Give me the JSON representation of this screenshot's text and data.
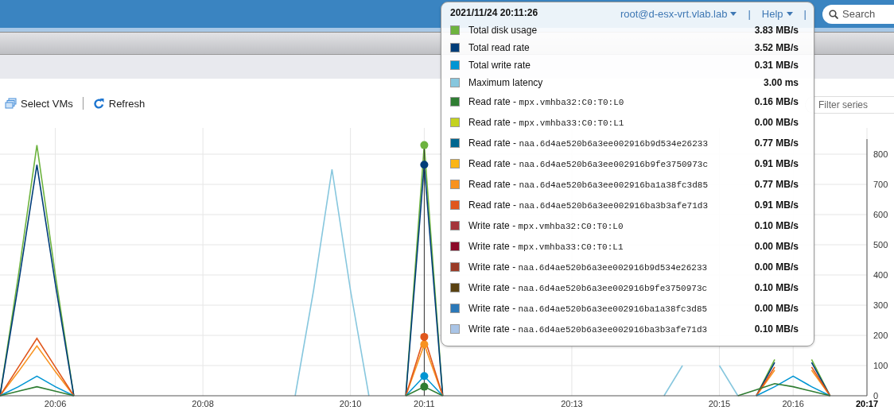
{
  "header": {
    "user": "root@d-esx-vrt.vlab.lab",
    "separator_1": "|",
    "help": "Help",
    "separator_2": "|",
    "search": {
      "placeholder": "Search"
    }
  },
  "toolbar": {
    "buttons": [
      {
        "kind": "select",
        "label": "Select VMs"
      },
      {
        "kind": "refresh",
        "label": "Refresh"
      }
    ]
  },
  "filter": {
    "placeholder": "Filter series"
  },
  "chart": {
    "chart_data": {
      "type": "line",
      "categories": [
        null,
        null,
        null,
        "20:06",
        null,
        null,
        null,
        null,
        null,
        null,
        null,
        "20:08",
        null,
        null,
        null,
        null,
        null,
        null,
        null,
        "20:10",
        null,
        null,
        null,
        "20:11",
        null,
        null,
        null,
        null,
        null,
        null,
        null,
        "20:13",
        null,
        null,
        null,
        null,
        null,
        null,
        null,
        "20:15",
        null,
        null,
        null,
        "20:16",
        null,
        null,
        null,
        "20:17"
      ],
      "series": [
        {
          "color": "#87c7de",
          "values": [
            null,
            null,
            null,
            null,
            null,
            null,
            null,
            null,
            null,
            null,
            null,
            null,
            null,
            null,
            null,
            null,
            0,
            350,
            750,
            350,
            0,
            null,
            null,
            null,
            null,
            null,
            null,
            null,
            null,
            null,
            null,
            null,
            null,
            null,
            null,
            null,
            0,
            100,
            null,
            100,
            0,
            null,
            null,
            null,
            null,
            null,
            null,
            null
          ]
        },
        {
          "color": "#6db33f",
          "values": [
            0,
            400,
            830,
            400,
            0,
            null,
            null,
            null,
            null,
            null,
            null,
            null,
            null,
            null,
            null,
            null,
            null,
            null,
            null,
            null,
            null,
            null,
            0,
            830,
            0,
            null,
            null,
            null,
            null,
            null,
            null,
            null,
            null,
            null,
            null,
            null,
            null,
            null,
            null,
            null,
            null,
            0,
            120,
            null,
            120,
            0,
            null,
            null
          ]
        },
        {
          "color": "#003d79",
          "values": [
            0,
            370,
            765,
            370,
            0,
            null,
            null,
            null,
            null,
            null,
            null,
            null,
            null,
            null,
            null,
            null,
            null,
            null,
            null,
            null,
            null,
            null,
            0,
            765,
            0,
            null,
            null,
            null,
            null,
            null,
            null,
            null,
            null,
            null,
            null,
            null,
            null,
            null,
            null,
            null,
            null,
            0,
            110,
            null,
            110,
            0,
            null,
            null
          ]
        },
        {
          "color": "#f8921f",
          "values": [
            0,
            80,
            165,
            80,
            0,
            null,
            null,
            null,
            null,
            null,
            null,
            null,
            null,
            null,
            null,
            null,
            null,
            null,
            null,
            null,
            null,
            null,
            0,
            170,
            0,
            null,
            null,
            null,
            null,
            null,
            null,
            null,
            null,
            null,
            null,
            null,
            null,
            null,
            null,
            null,
            null,
            0,
            85,
            null,
            85,
            0,
            null,
            null
          ]
        },
        {
          "color": "#e0571c",
          "values": [
            0,
            95,
            190,
            95,
            0,
            null,
            null,
            null,
            null,
            null,
            null,
            null,
            null,
            null,
            null,
            null,
            null,
            null,
            null,
            null,
            null,
            null,
            0,
            195,
            0,
            null,
            null,
            null,
            null,
            null,
            null,
            null,
            null,
            null,
            null,
            null,
            null,
            null,
            null,
            null,
            null,
            0,
            95,
            null,
            95,
            0,
            null,
            null
          ]
        },
        {
          "color": "#0095d3",
          "values": [
            0,
            30,
            65,
            30,
            0,
            null,
            null,
            null,
            null,
            null,
            null,
            null,
            null,
            null,
            null,
            null,
            null,
            null,
            null,
            null,
            null,
            null,
            0,
            65,
            0,
            null,
            null,
            null,
            null,
            null,
            null,
            null,
            null,
            null,
            null,
            null,
            null,
            null,
            null,
            null,
            null,
            0,
            30,
            65,
            30,
            0,
            null,
            null
          ]
        },
        {
          "color": "#2f7d32",
          "values": [
            0,
            15,
            30,
            15,
            0,
            null,
            null,
            null,
            null,
            null,
            null,
            null,
            null,
            null,
            null,
            null,
            null,
            null,
            null,
            null,
            null,
            null,
            0,
            30,
            0,
            null,
            null,
            null,
            null,
            null,
            null,
            null,
            null,
            null,
            null,
            null,
            null,
            null,
            null,
            null,
            0,
            20,
            40,
            30,
            15,
            0,
            null,
            null
          ]
        }
      ],
      "ylim": [
        0,
        850
      ],
      "yticks": [
        0,
        100,
        200,
        300,
        400,
        500,
        600,
        700,
        800
      ],
      "grid": true,
      "annotations": [
        {
          "x": "20:11"
        }
      ]
    }
  },
  "tooltip": {
    "time": "2021/11/24 20:11:26",
    "rows": [
      {
        "color": "#6db33f",
        "label": "Total disk usage",
        "value": "3.83 MB/s"
      },
      {
        "color": "#003d79",
        "label": "Total read rate",
        "value": "3.52 MB/s"
      },
      {
        "color": "#0095d3",
        "label": "Total write rate",
        "value": "0.31 MB/s"
      },
      {
        "color": "#87c7de",
        "label": "Maximum latency",
        "value": "3.00 ms"
      },
      {
        "color": "#2f7d32",
        "label": "Read rate - ",
        "device": "mpx.vmhba32:C0:T0:L0",
        "value": "0.16 MB/s"
      },
      {
        "color": "#c4d21f",
        "label": "Read rate - ",
        "device": "mpx.vmhba33:C0:T0:L1",
        "value": "0.00 MB/s"
      },
      {
        "color": "#006690",
        "label": "Read rate - ",
        "device": "naa.6d4ae520b6a3ee002916b9d534e26233",
        "value": "0.77 MB/s"
      },
      {
        "color": "#fbb516",
        "label": "Read rate - ",
        "device": "naa.6d4ae520b6a3ee002916b9fe3750973c",
        "value": "0.91 MB/s"
      },
      {
        "color": "#f8921f",
        "label": "Read rate - ",
        "device": "naa.6d4ae520b6a3ee002916ba1a38fc3d85",
        "value": "0.77 MB/s"
      },
      {
        "color": "#e0571c",
        "label": "Read rate - ",
        "device": "naa.6d4ae520b6a3ee002916ba3b3afe71d3",
        "value": "0.91 MB/s"
      },
      {
        "color": "#a4343b",
        "label": "Write rate - ",
        "device": "mpx.vmhba32:C0:T0:L0",
        "value": "0.10 MB/s"
      },
      {
        "color": "#8b0a29",
        "label": "Write rate - ",
        "device": "mpx.vmhba33:C0:T0:L1",
        "value": "0.00 MB/s"
      },
      {
        "color": "#9a3b26",
        "label": "Write rate - ",
        "device": "naa.6d4ae520b6a3ee002916b9d534e26233",
        "value": "0.00 MB/s"
      },
      {
        "color": "#5a4211",
        "label": "Write rate - ",
        "device": "naa.6d4ae520b6a3ee002916b9fe3750973c",
        "value": "0.10 MB/s"
      },
      {
        "color": "#2b78b8",
        "label": "Write rate - ",
        "device": "naa.6d4ae520b6a3ee002916ba1a38fc3d85",
        "value": "0.00 MB/s"
      },
      {
        "color": "#a9c4e6",
        "label": "Write rate - ",
        "device": "naa.6d4ae520b6a3ee002916ba3b3afe71d3",
        "value": "0.10 MB/s"
      }
    ]
  }
}
